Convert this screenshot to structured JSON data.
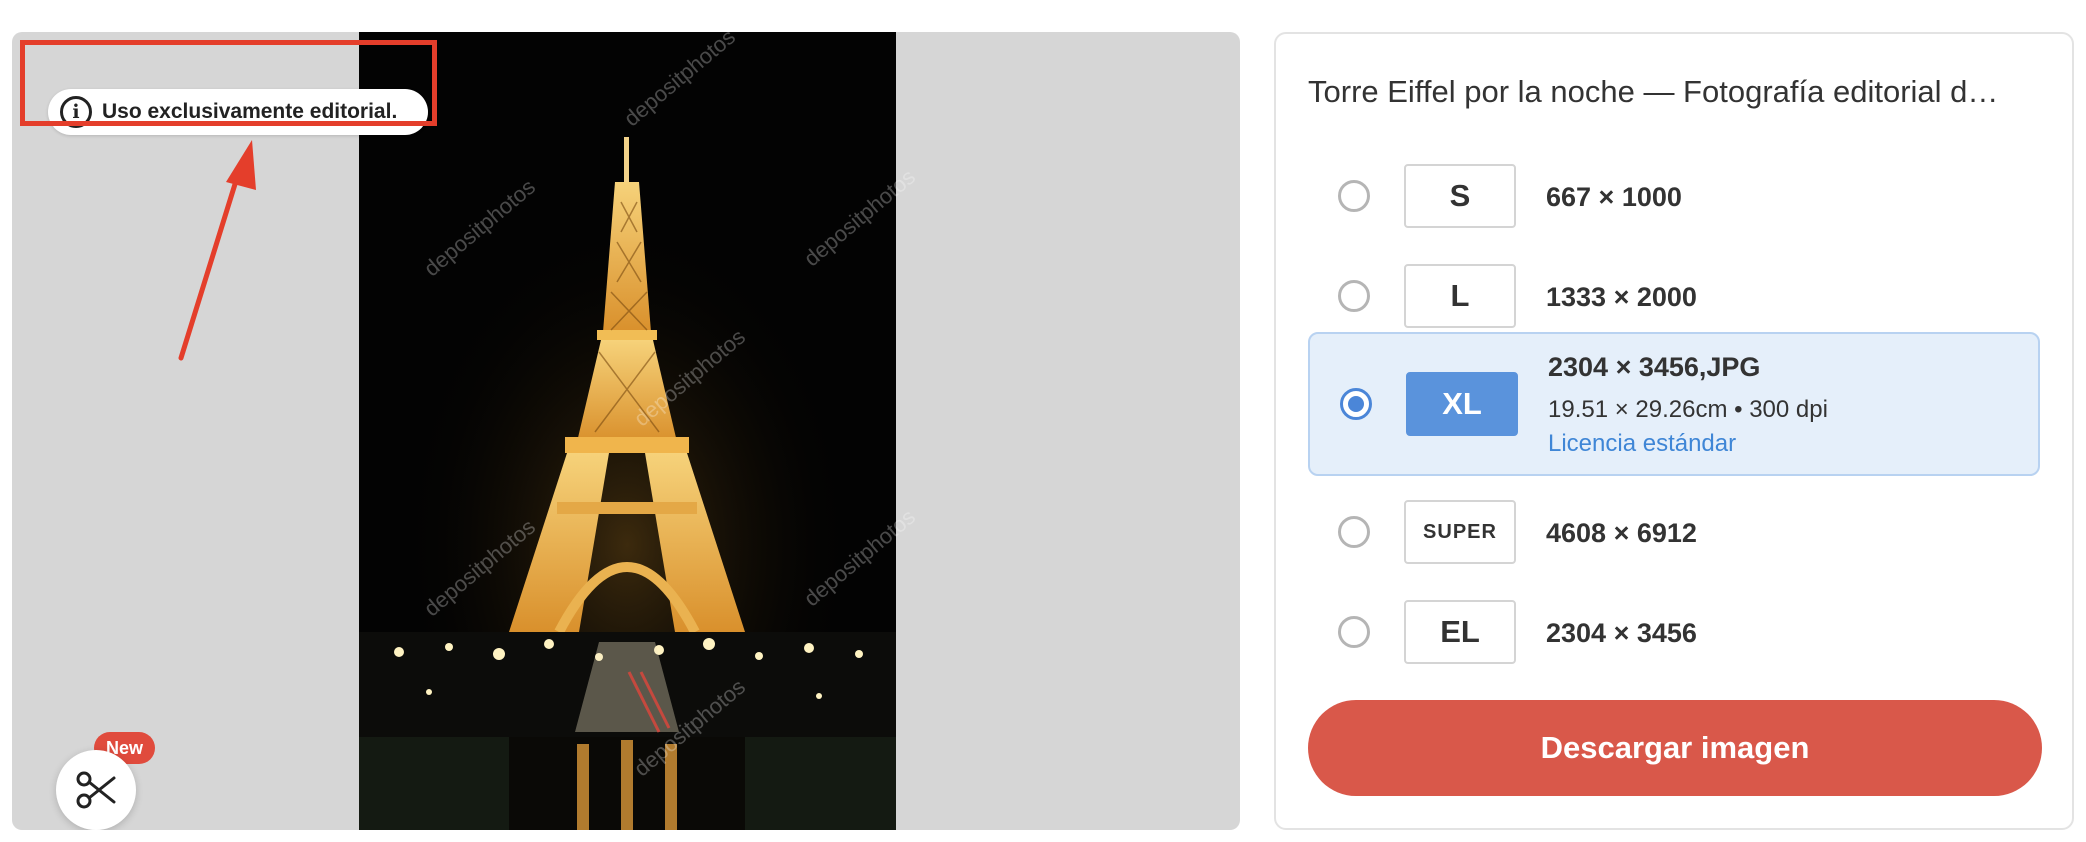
{
  "preview": {
    "notice": "Uso exclusivamente editorial.",
    "watermark": "depositphotos",
    "new_badge": "New",
    "icons": {
      "info": "info-icon",
      "scissors": "scissors-icon"
    }
  },
  "panel": {
    "title": "Torre Eiffel por la noche — Fotografía editorial d…",
    "options": [
      {
        "size": "S",
        "dimensions": "667 × 1000",
        "selected": false
      },
      {
        "size": "L",
        "dimensions": "1333 × 2000",
        "selected": false
      },
      {
        "size": "XL",
        "dimensions": "2304 × 3456,JPG",
        "detail": "19.51 × 29.26cm • 300 dpi",
        "license": "Licencia estándar",
        "selected": true
      },
      {
        "size": "SUPER",
        "dimensions": "4608 × 6912",
        "selected": false
      },
      {
        "size": "EL",
        "dimensions": "2304 × 3456",
        "selected": false
      }
    ],
    "download_label": "Descargar imagen"
  },
  "colors": {
    "accent_blue": "#5a93dc",
    "download_red": "#d9584a",
    "highlight_red": "#e43e2b",
    "selected_bg": "#e5effa"
  }
}
